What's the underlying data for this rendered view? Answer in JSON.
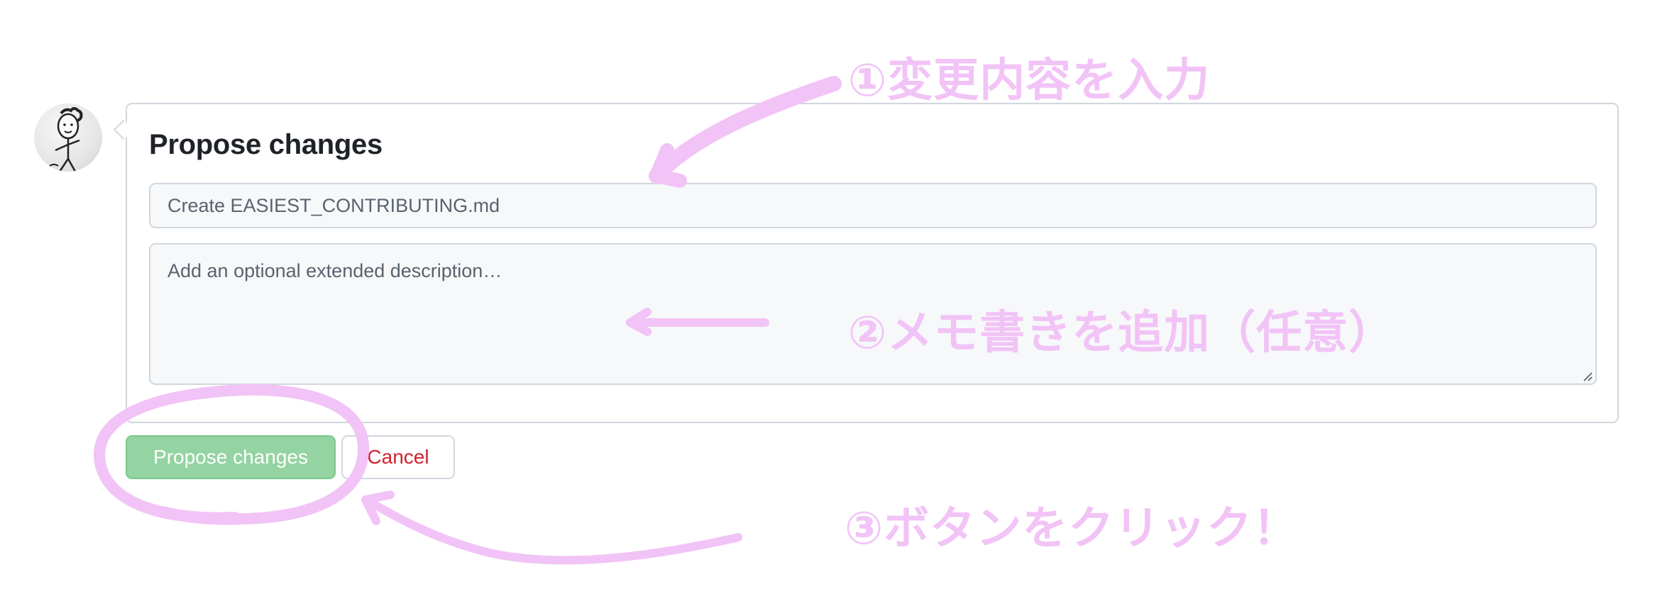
{
  "panel": {
    "title": "Propose changes"
  },
  "form": {
    "commit_message_value": "Create EASIEST_CONTRIBUTING.md",
    "description_placeholder": "Add an optional extended description…"
  },
  "buttons": {
    "propose_label": "Propose changes",
    "cancel_label": "Cancel"
  },
  "annotations": {
    "step1": "①変更内容を入力",
    "step2": "②メモ書きを追加（任意）",
    "step3": "③ボタンをクリック！"
  },
  "colors": {
    "annotation": "#f2c3f6",
    "propose_button": "#94d3a2",
    "cancel_text": "#cf222e",
    "border": "#d0d7de"
  },
  "icons": {
    "avatar": "stick-figure-avatar-icon"
  }
}
